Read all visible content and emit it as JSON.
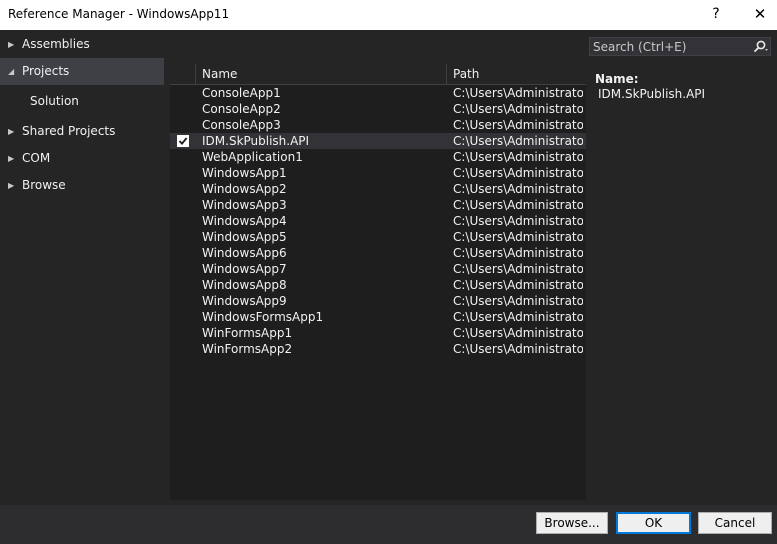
{
  "window": {
    "title": "Reference Manager - WindowsApp11",
    "help_glyph": "?",
    "close_glyph": "✕"
  },
  "nav": {
    "items": [
      {
        "label": "Assemblies",
        "arrow": "▶"
      },
      {
        "label": "Projects",
        "arrow": "◢"
      },
      {
        "label": "Solution",
        "arrow": ""
      },
      {
        "label": "Shared Projects",
        "arrow": "▶"
      },
      {
        "label": "COM",
        "arrow": "▶"
      },
      {
        "label": "Browse",
        "arrow": "▶"
      }
    ]
  },
  "list": {
    "columns": {
      "name": "Name",
      "path": "Path"
    },
    "rows": [
      {
        "name": "ConsoleApp1",
        "path": "C:\\Users\\Administrato...",
        "checked": false
      },
      {
        "name": "ConsoleApp2",
        "path": "C:\\Users\\Administrato...",
        "checked": false
      },
      {
        "name": "ConsoleApp3",
        "path": "C:\\Users\\Administrato...",
        "checked": false
      },
      {
        "name": "IDM.SkPublish.API",
        "path": "C:\\Users\\Administrato...",
        "checked": true
      },
      {
        "name": "WebApplication1",
        "path": "C:\\Users\\Administrato...",
        "checked": false
      },
      {
        "name": "WindowsApp1",
        "path": "C:\\Users\\Administrato...",
        "checked": false
      },
      {
        "name": "WindowsApp2",
        "path": "C:\\Users\\Administrato...",
        "checked": false
      },
      {
        "name": "WindowsApp3",
        "path": "C:\\Users\\Administrato...",
        "checked": false
      },
      {
        "name": "WindowsApp4",
        "path": "C:\\Users\\Administrato...",
        "checked": false
      },
      {
        "name": "WindowsApp5",
        "path": "C:\\Users\\Administrato...",
        "checked": false
      },
      {
        "name": "WindowsApp6",
        "path": "C:\\Users\\Administrato...",
        "checked": false
      },
      {
        "name": "WindowsApp7",
        "path": "C:\\Users\\Administrato...",
        "checked": false
      },
      {
        "name": "WindowsApp8",
        "path": "C:\\Users\\Administrato...",
        "checked": false
      },
      {
        "name": "WindowsApp9",
        "path": "C:\\Users\\Administrato...",
        "checked": false
      },
      {
        "name": "WindowsFormsApp1",
        "path": "C:\\Users\\Administrato...",
        "checked": false
      },
      {
        "name": "WinFormsApp1",
        "path": "C:\\Users\\Administrato...",
        "checked": false
      },
      {
        "name": "WinFormsApp2",
        "path": "C:\\Users\\Administrato...",
        "checked": false
      }
    ]
  },
  "search": {
    "placeholder": "Search (Ctrl+E)",
    "icon": "search-icon",
    "dropdown_glyph": "▾"
  },
  "details": {
    "name_label": "Name:",
    "name_value": "IDM.SkPublish.API"
  },
  "buttons": {
    "browse": "Browse...",
    "ok": "OK",
    "cancel": "Cancel"
  },
  "colors": {
    "background": "#252526",
    "list_background": "#1e1e1e",
    "selection": "#3f3f46",
    "focus_border": "#0078d7"
  }
}
